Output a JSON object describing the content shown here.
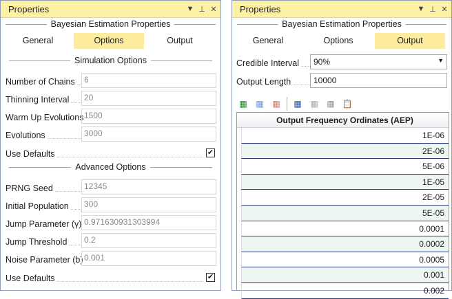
{
  "left": {
    "title": "Properties",
    "group": "Bayesian Estimation Properties",
    "tabs": [
      "General",
      "Options",
      "Output"
    ],
    "sim_heading": "Simulation Options",
    "sim": [
      {
        "label": "Number of Chains",
        "value": "6"
      },
      {
        "label": "Thinning Interval",
        "value": "20"
      },
      {
        "label": "Warm Up Evolutions",
        "value": "1500"
      },
      {
        "label": "Evolutions",
        "value": "3000"
      }
    ],
    "sim_defaults": "Use Defaults",
    "adv_heading": "Advanced Options",
    "adv": [
      {
        "label": "PRNG Seed",
        "value": "12345"
      },
      {
        "label": "Initial Population",
        "value": "300"
      },
      {
        "label": "Jump Parameter (γ)",
        "value": "0.971630931303994"
      },
      {
        "label": "Jump Threshold",
        "value": "0.2"
      },
      {
        "label": "Noise Parameter (b)",
        "value": "0.001"
      }
    ],
    "adv_defaults": "Use Defaults"
  },
  "right": {
    "title": "Properties",
    "group": "Bayesian Estimation Properties",
    "tabs": [
      "General",
      "Options",
      "Output"
    ],
    "credible_label": "Credible Interval",
    "credible_value": "90%",
    "length_label": "Output Length",
    "length_value": "10000",
    "grid_header": "Output Frequency Ordinates (AEP)",
    "rows": [
      "1E-06",
      "2E-06",
      "5E-06",
      "1E-05",
      "2E-05",
      "5E-05",
      "0.0001",
      "0.0002",
      "0.0005",
      "0.001",
      "0.002"
    ]
  }
}
